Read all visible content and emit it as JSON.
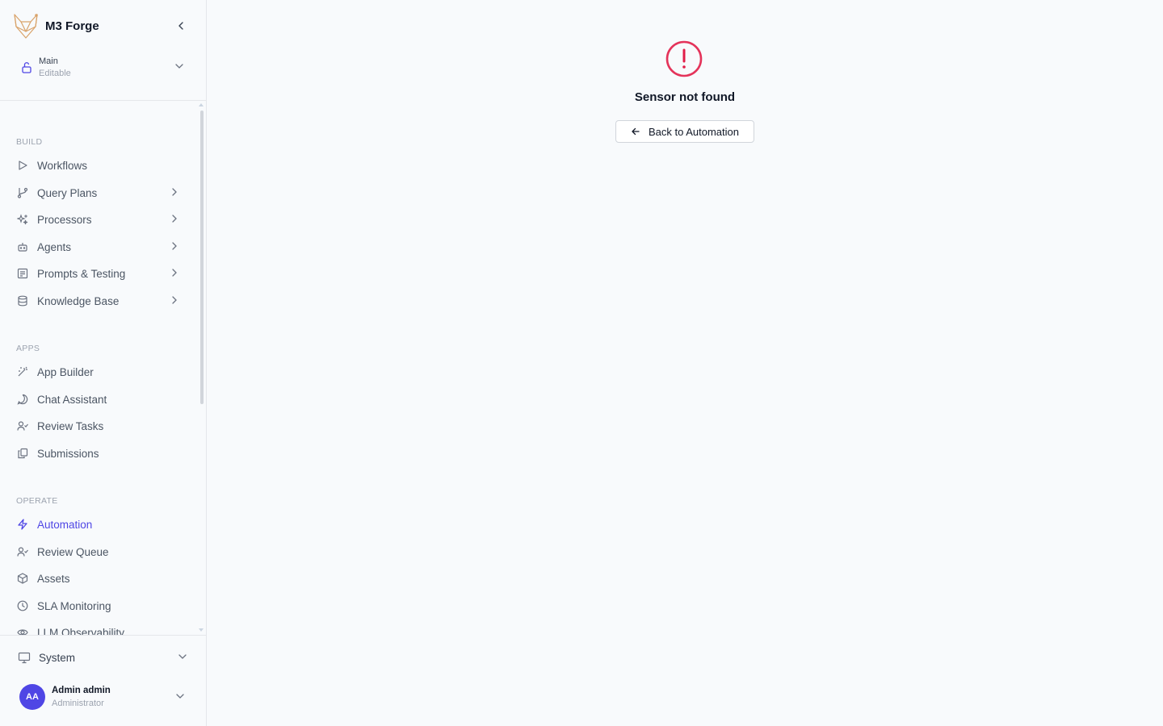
{
  "brand": {
    "name": "M3 Forge"
  },
  "branch": {
    "name": "Main",
    "status": "Editable"
  },
  "sections": {
    "build": "BUILD",
    "apps": "APPS",
    "operate": "OPERATE"
  },
  "nav": {
    "workflows": "Workflows",
    "query_plans": "Query Plans",
    "processors": "Processors",
    "agents": "Agents",
    "prompts_testing": "Prompts & Testing",
    "knowledge_base": "Knowledge Base",
    "app_builder": "App Builder",
    "chat_assistant": "Chat Assistant",
    "review_tasks": "Review Tasks",
    "submissions": "Submissions",
    "automation": "Automation",
    "review_queue": "Review Queue",
    "assets": "Assets",
    "sla_monitoring": "SLA Monitoring",
    "llm_observability": "LLM Observability"
  },
  "system": {
    "label": "System"
  },
  "user": {
    "initials": "AA",
    "name": "Admin admin",
    "role": "Administrator"
  },
  "main": {
    "error_title": "Sensor not found",
    "back_label": "Back to Automation"
  },
  "colors": {
    "accent": "#4f46e5",
    "error": "#e11d48"
  }
}
